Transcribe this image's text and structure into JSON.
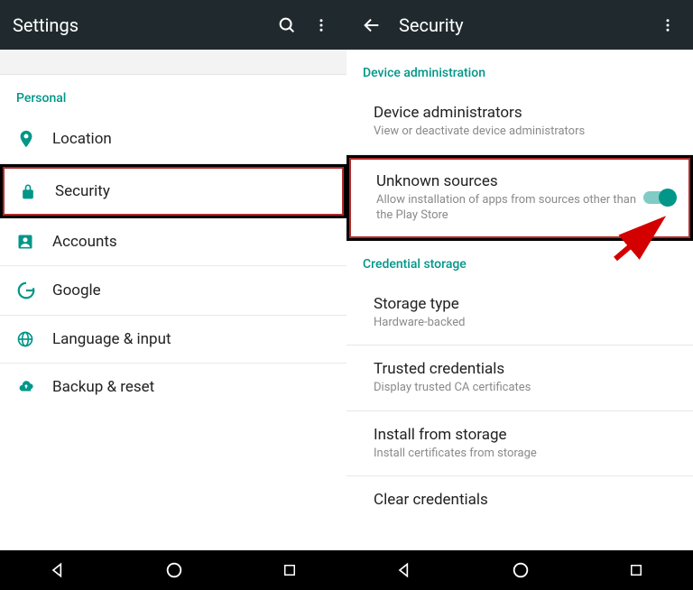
{
  "left": {
    "appbar_title": "Settings",
    "section": "Personal",
    "items": [
      {
        "label": "Location"
      },
      {
        "label": "Security"
      },
      {
        "label": "Accounts"
      },
      {
        "label": "Google"
      },
      {
        "label": "Language & input"
      },
      {
        "label": "Backup & reset"
      }
    ]
  },
  "right": {
    "appbar_title": "Security",
    "section1": "Device administration",
    "device_admin": {
      "title": "Device administrators",
      "sub": "View or deactivate device administrators"
    },
    "unknown_sources": {
      "title": "Unknown sources",
      "sub": "Allow installation of apps from sources other than the Play Store"
    },
    "section2": "Credential storage",
    "storage_type": {
      "title": "Storage type",
      "sub": "Hardware-backed"
    },
    "trusted": {
      "title": "Trusted credentials",
      "sub": "Display trusted CA certificates"
    },
    "install": {
      "title": "Install from storage",
      "sub": "Install certificates from storage"
    },
    "clear": {
      "title": "Clear credentials"
    }
  },
  "colors": {
    "accent": "#009688"
  }
}
